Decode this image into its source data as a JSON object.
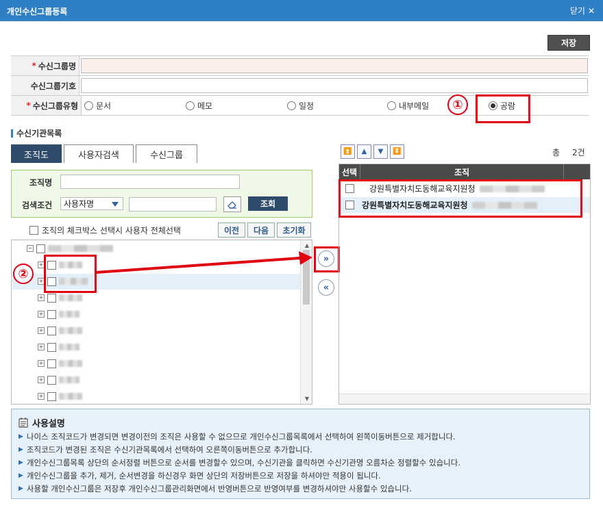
{
  "window": {
    "title": "개인수신그룹등록",
    "close_label": "닫기"
  },
  "toolbar": {
    "save_label": "저장"
  },
  "form": {
    "group_name_label": "수신그룹명",
    "group_code_label": "수신그룹기호",
    "group_type_label": "수신그룹유형",
    "types": [
      "문서",
      "메모",
      "일정",
      "내부메일",
      "공람"
    ],
    "selected_type": "공람"
  },
  "annotations": {
    "circle1": "①",
    "circle2": "②"
  },
  "section": {
    "title": "수신기관목록"
  },
  "tabs": [
    "조직도",
    "사용자검색",
    "수신그룹"
  ],
  "search": {
    "org_label": "조직명",
    "cond_label": "검색조건",
    "cond_value": "사용자명",
    "query_label": "조회"
  },
  "tree_controls": {
    "select_all_label": "조직의 체크박스 선택시 사용자 전체선택",
    "prev_label": "이전",
    "next_label": "다음",
    "reset_label": "초기화"
  },
  "move": {
    "right_label": "»",
    "left_label": "«"
  },
  "list": {
    "total_label": "총",
    "count": "2건",
    "col_select": "선택",
    "col_org": "조직",
    "rows": [
      "강원특별자치도동해교육지원청",
      "강원특별자치도동해교육지원청"
    ]
  },
  "help": {
    "title": "사용설명",
    "items": [
      "나이스 조직코드가 변경되면 변경이전의 조직은 사용할 수 없으므로 개인수신그룹목록에서 선택하여 왼쪽이동버튼으로 제거합니다.",
      "조직코드가 변경된 조직은 수신기관목록에서 선택하여 오른쪽이동버튼으로 추가합니다.",
      "개인수신그룹목록 상단의 순서정렬 버튼으로 순서를 변경할수 있으며, 수신기관을 클릭하면 수신기관명 오름차순 정렬할수 있습니다.",
      "개인수신그룹을 추가, 제거, 순서변경을 하신경우 화면 상단의 저장버튼으로 저장을 하셔야만 적용이 됩니다.",
      "사용할 개인수신그룹은 저장후 개인수신그룹관리화면에서 반영버튼으로 반영여부를 변경하셔야만 사용할수 있습니다."
    ]
  },
  "colors": {
    "header": "#2f7fc5",
    "accent_dark": "#2e4b6b",
    "annotation": "#e00010"
  }
}
